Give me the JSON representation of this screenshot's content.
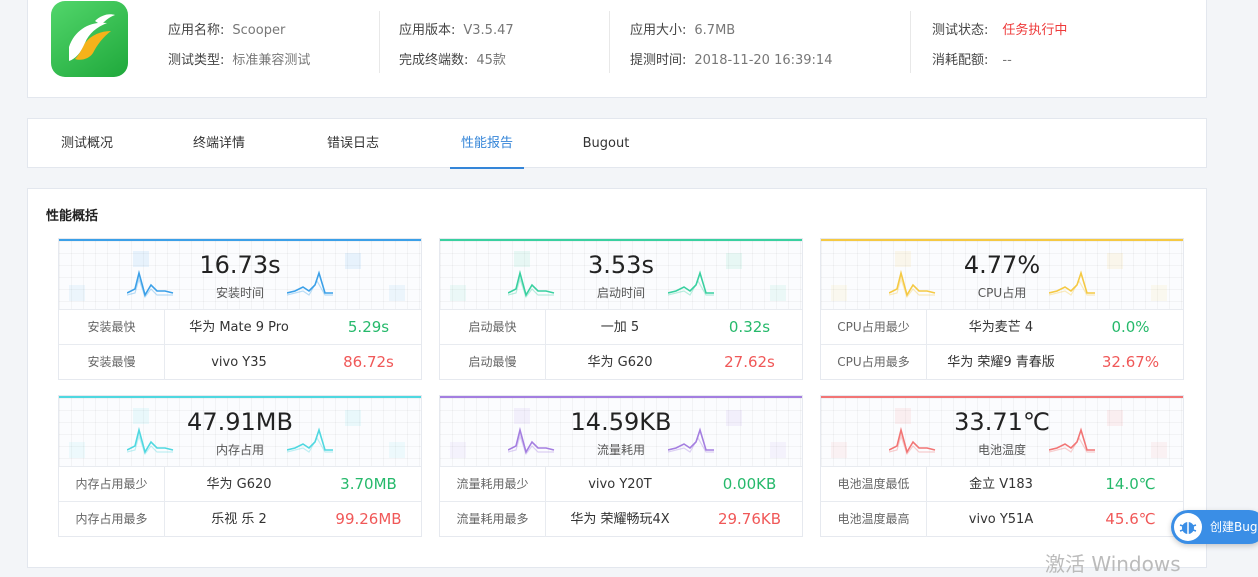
{
  "app": {
    "fields": [
      {
        "label": "应用名称:",
        "value": "Scooper"
      },
      {
        "label": "测试类型:",
        "value": "标准兼容测试"
      },
      {
        "label": "应用版本:",
        "value": "V3.5.47"
      },
      {
        "label": "完成终端数:",
        "value": "45款"
      },
      {
        "label": "应用大小:",
        "value": "6.7MB"
      },
      {
        "label": "提测时间:",
        "value": "2018-11-20 16:39:14"
      },
      {
        "label": "测试状态:",
        "value": "任务执行中"
      },
      {
        "label": "消耗配额:",
        "value": "--"
      }
    ]
  },
  "tabs": [
    "测试概况",
    "终端详情",
    "错误日志",
    "性能报告",
    "Bugout"
  ],
  "active_tab": "性能报告",
  "perf": {
    "title": "性能概括",
    "metrics": [
      {
        "value": "16.73s",
        "label": "安装时间",
        "color": "#3ba0e8",
        "rows": [
          {
            "k": "安装最快",
            "d": "华为 Mate 9 Pro",
            "v": "5.29s"
          },
          {
            "k": "安装最慢",
            "d": "vivo Y35",
            "v": "86.72s"
          }
        ]
      },
      {
        "value": "3.53s",
        "label": "启动时间",
        "color": "#39d0a0",
        "rows": [
          {
            "k": "启动最快",
            "d": "一加 5",
            "v": "0.32s"
          },
          {
            "k": "启动最慢",
            "d": "华为 G620",
            "v": "27.62s"
          }
        ]
      },
      {
        "value": "4.77%",
        "label": "CPU占用",
        "color": "#f5c943",
        "rows": [
          {
            "k": "CPU占用最少",
            "d": "华为麦芒 4",
            "v": "0.0%"
          },
          {
            "k": "CPU占用最多",
            "d": "华为 荣耀9 青春版",
            "v": "32.67%"
          }
        ]
      },
      {
        "value": "47.91MB",
        "label": "内存占用",
        "color": "#4fd8e0",
        "rows": [
          {
            "k": "内存占用最少",
            "d": "华为 G620",
            "v": "3.70MB"
          },
          {
            "k": "内存占用最多",
            "d": "乐视 乐 2",
            "v": "99.26MB"
          }
        ]
      },
      {
        "value": "14.59KB",
        "label": "流量耗用",
        "color": "#a47ee0",
        "rows": [
          {
            "k": "流量耗用最少",
            "d": "vivo Y20T",
            "v": "0.00KB"
          },
          {
            "k": "流量耗用最多",
            "d": "华为 荣耀畅玩4X",
            "v": "29.76KB"
          }
        ]
      },
      {
        "value": "33.71℃",
        "label": "电池温度",
        "color": "#f27575",
        "rows": [
          {
            "k": "电池温度最低",
            "d": "金立 V183",
            "v": "14.0℃"
          },
          {
            "k": "电池温度最高",
            "d": "vivo Y51A",
            "v": "45.6℃"
          }
        ]
      }
    ]
  },
  "bug_button": "创建Bug",
  "watermark": "激活 Windows",
  "icons": {
    "app": "app-logo-icon",
    "bug": "bug-icon"
  }
}
